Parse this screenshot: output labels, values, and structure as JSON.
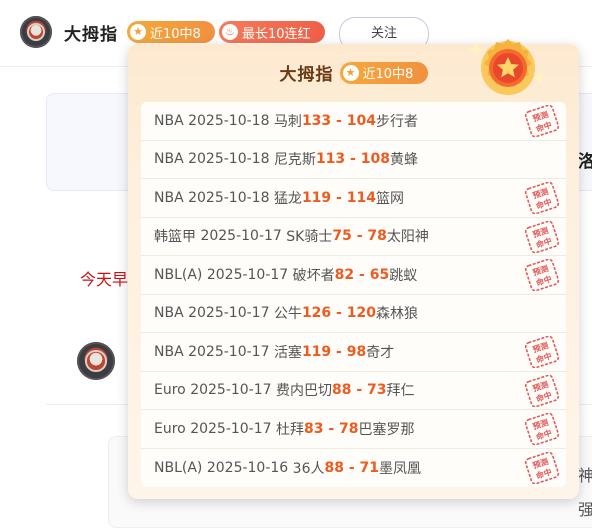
{
  "user": {
    "name": "大拇指",
    "hits_badge": "近10中8",
    "streak_badge": "最长10连红",
    "follow_label": "关注"
  },
  "background": {
    "clipped_heading": "洛",
    "red_text": "今天早",
    "clipped_text_1": "神",
    "clipped_text_2": "强"
  },
  "popup": {
    "title": "大拇指",
    "badge": "近10中8",
    "stamp_line1": "预测",
    "stamp_line2": "命中",
    "records": [
      {
        "league": "NBA",
        "date": "2025-10-18",
        "home": "马刺",
        "score": "133 - 104",
        "away": "步行者",
        "hit": true
      },
      {
        "league": "NBA",
        "date": "2025-10-18",
        "home": "尼克斯",
        "score": "113 - 108",
        "away": "黄蜂",
        "hit": false
      },
      {
        "league": "NBA",
        "date": "2025-10-18",
        "home": "猛龙",
        "score": "119 - 114",
        "away": "篮网",
        "hit": true
      },
      {
        "league": "韩篮甲",
        "date": "2025-10-17",
        "home": "SK骑士",
        "score": "75 - 78",
        "away": "太阳神",
        "hit": true
      },
      {
        "league": "NBL(A)",
        "date": "2025-10-17",
        "home": "破坏者",
        "score": "82 - 65",
        "away": "跳蚁",
        "hit": true
      },
      {
        "league": "NBA",
        "date": "2025-10-17",
        "home": "公牛",
        "score": "126 - 120",
        "away": "森林狼",
        "hit": false
      },
      {
        "league": "NBA",
        "date": "2025-10-17",
        "home": "活塞",
        "score": "119 - 98",
        "away": "奇才",
        "hit": true
      },
      {
        "league": "Euro",
        "date": "2025-10-17",
        "home": "费内巴切",
        "score": "88 - 73",
        "away": "拜仁",
        "hit": true
      },
      {
        "league": "Euro",
        "date": "2025-10-17",
        "home": "杜拜",
        "score": "83 - 78",
        "away": "巴塞罗那",
        "hit": true
      },
      {
        "league": "NBL(A)",
        "date": "2025-10-16",
        "home": "36人",
        "score": "88 - 71",
        "away": "墨凤凰",
        "hit": true
      }
    ]
  },
  "colors": {
    "score": "#ef5a1e",
    "stamp": "#e35a5a",
    "badge_orange": "#f3a134",
    "badge_red": "#ef6a4d"
  }
}
